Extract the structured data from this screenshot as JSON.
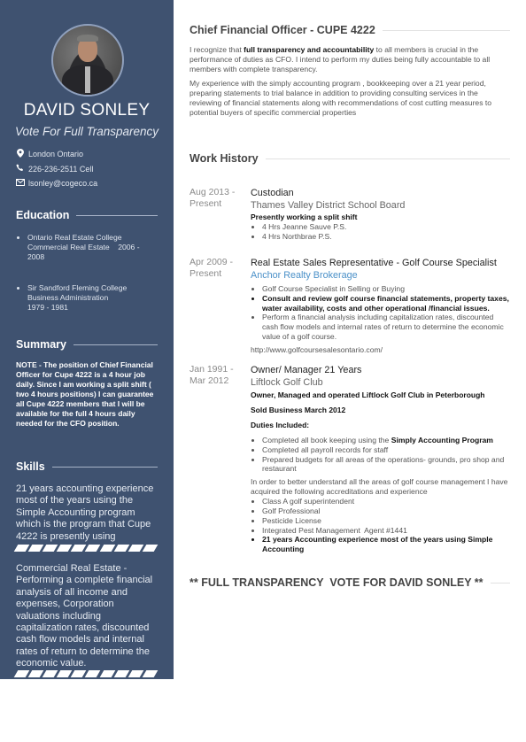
{
  "sidebar": {
    "name": "DAVID SONLEY",
    "tagline": "Vote For Full Transparency",
    "photo_alt": "profile-photo",
    "contact": {
      "location": "London Ontario",
      "phone": "226-236-2511 Cell",
      "email": "lsonley@cogeco.ca"
    },
    "education": {
      "heading": "Education",
      "items": [
        {
          "line1": "Ontario Real Estate College",
          "line2": "Commercial Real Estate    2006 -",
          "line3": "2008"
        },
        {
          "line1": "Sir Sandford Fleming College",
          "line2": "Business Administration",
          "line3": "1979 - 1981"
        }
      ]
    },
    "summary": {
      "heading": "Summary",
      "text": "NOTE - The position of Chief Financial Officer for Cupe 4222 is a 4 hour job daily. Since I am working a split shift ( two 4 hours positions) I can guarantee all Cupe 4222 members that I will be available  for the full 4 hours daily needed for the CFO position."
    },
    "skills": {
      "heading": "Skills",
      "items": [
        {
          "text": "21 years accounting experience most of the years using the Simple Accounting program which is the program that Cupe 4222 is presently using",
          "level_segments_filled": 10,
          "level_segments_total": 10
        },
        {
          "text": "Commercial Real Estate - Performing a complete financial analysis of all income and expenses, Corporation valuations including capitalization rates, discounted cash flow models and internal rates of return to determine the economic value.",
          "level_segments_filled": 10,
          "level_segments_total": 10
        }
      ]
    }
  },
  "main": {
    "objective": {
      "heading": "Chief Financial Officer - CUPE 4222",
      "p1_pre": "I recognize that ",
      "p1_bold": "full transparency and accountability",
      "p1_post": " to  all members is crucial in the performance of duties as CFO. I intend to perform my duties being fully accountable to all members with complete transparency.",
      "p2": "My experience with the simply accounting program , bookkeeping over a 21 year period, preparing statements to trial balance in addition to providing consulting services in the reviewing of financial statements along with recommendations of cost cutting measures to potential buyers of specific commercial properties"
    },
    "work_history": {
      "heading": "Work History",
      "jobs": [
        {
          "date_start": "Aug 2013 -",
          "date_end": "Present",
          "title": "Custodian",
          "company": "Thames Valley District School Board",
          "subhead": "Presently working a split shift",
          "bullets": [
            "4 Hrs Jeanne Sauve P.S.",
            "4 Hrs Northbrae P.S."
          ]
        },
        {
          "date_start": "Apr 2009 -",
          "date_end": "Present",
          "title": "Real Estate Sales Representative - Golf Course Specialist",
          "company": "Anchor Realty Brokerage",
          "bullets": [
            "Golf Course Specialist in Selling or Buying",
            "Consult and review golf course financial statements, property taxes, water availability, costs and other operational /financial issues.",
            "Perform a financial analysis including capitalization rates, discounted cash flow models and internal rates of return to determine the economic value of a golf course."
          ],
          "url": "http://www.golfcoursesalesontario.com/"
        },
        {
          "date_start": "Jan 1991 -",
          "date_end": "Mar 2012",
          "title": "Owner/ Manager 21 Years",
          "company": "Liftlock Golf Club",
          "subhead1": "Owner, Managed and operated Liftlock Golf Club in Peterborough",
          "subhead2": "Sold Business March 2012",
          "subhead3": "Duties Included:",
          "duties": {
            "d1_pre": "Completed all book keeping using the ",
            "d1_bold": "Simply Accounting Program",
            "d2": "Completed all payroll records for staff",
            "d3": "Prepared budgets for all areas of the operations- grounds, pro shop and restaurant"
          },
          "para": "In order to better understand all the areas of golf course management I have acquired the following accreditations and experience",
          "accreditations": [
            "Class A golf superintendent",
            "Golf Professional",
            "Pesticide License",
            "Integrated Pest Management  Agent #1441",
            "21 years Accounting experience most of the years using Simple Accounting"
          ]
        }
      ]
    },
    "footer_heading": "** FULL TRANSPARENCY  VOTE FOR DAVID SONLEY **"
  }
}
